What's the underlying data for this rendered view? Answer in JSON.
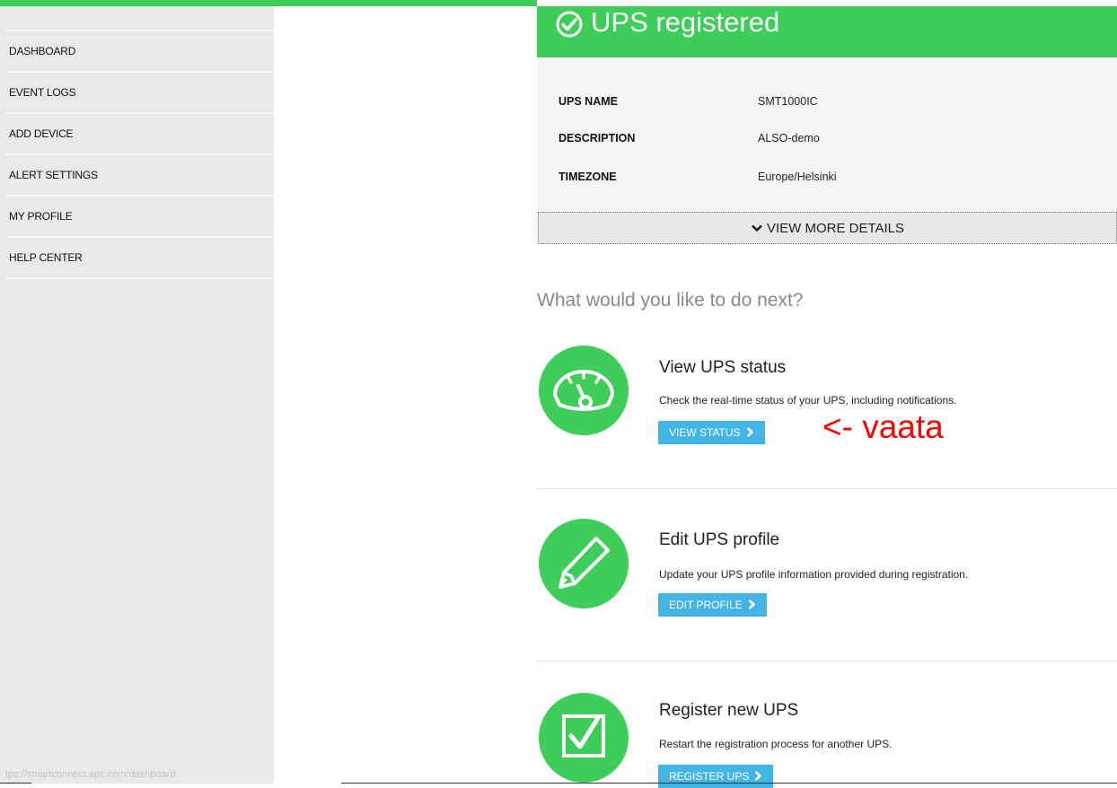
{
  "sidebar": {
    "items": [
      {
        "label": "DASHBOARD"
      },
      {
        "label": "EVENT LOGS"
      },
      {
        "label": "ADD DEVICE"
      },
      {
        "label": "ALERT SETTINGS"
      },
      {
        "label": "MY PROFILE"
      },
      {
        "label": "HELP CENTER"
      }
    ],
    "status_url": "tps://smartconnect.apc.com/dashboard"
  },
  "banner": {
    "title": "UPS registered",
    "icon": "check-circle-icon"
  },
  "details": {
    "rows": [
      {
        "label": "UPS NAME",
        "value": "SMT1000IC"
      },
      {
        "label": "DESCRIPTION",
        "value": "ALSO-demo"
      },
      {
        "label": "TIMEZONE",
        "value": "Europe/Helsinki"
      }
    ],
    "more_label": "VIEW MORE DETAILS"
  },
  "next": {
    "heading": "What would you like to do next?",
    "actions": [
      {
        "title": "View UPS status",
        "description": "Check the real-time status of your UPS, including notifications.",
        "button": "VIEW STATUS",
        "icon": "gauge-icon"
      },
      {
        "title": "Edit UPS profile",
        "description": "Update your UPS profile information provided during registration.",
        "button": "EDIT PROFILE",
        "icon": "pencil-icon"
      },
      {
        "title": "Register new UPS",
        "description": "Restart the registration process for another UPS.",
        "button": "REGISTER UPS",
        "icon": "checkbox-icon"
      }
    ]
  },
  "annotation": "<- vaata",
  "colors": {
    "brand_green": "#3dcd58",
    "button_blue": "#42b4e6",
    "sidebar_bg": "#e9e9e9",
    "annotation_red": "#ff0000"
  }
}
